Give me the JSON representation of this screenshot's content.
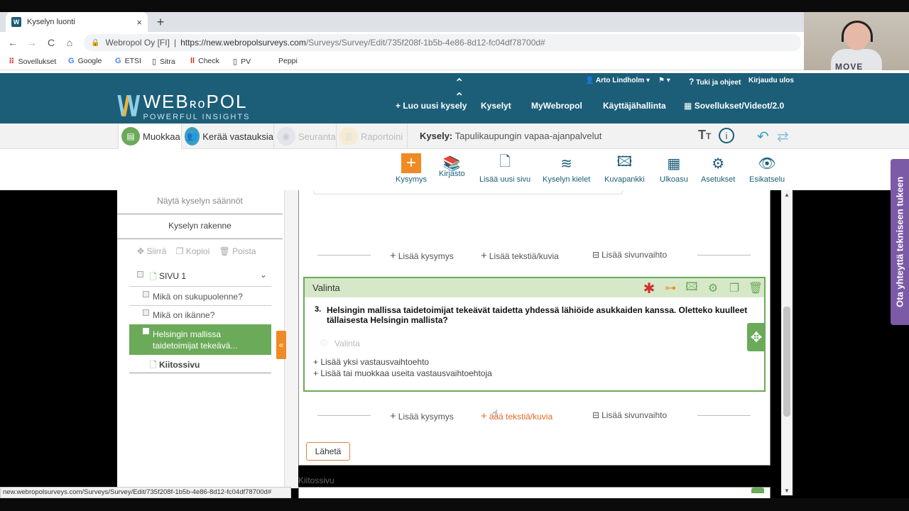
{
  "browser": {
    "tab_title": "Kyselyn luonti",
    "tab_close": "×",
    "new_tab": "+",
    "back": "←",
    "forward": "→",
    "reload": "C",
    "home": "⌂",
    "site_label": "Webropol Oy [FI]",
    "separator": "|",
    "url_host": "https://new.webropolsurveys.com",
    "url_path": "/Surveys/Survey/Edit/735f208f-1b5b-4e86-8d12-fc04df78700d#",
    "bookmarks": [
      "Sovellukset",
      "Google",
      "ETSI",
      "Sitra",
      "Check",
      "PV",
      "Peppi"
    ]
  },
  "webcam": {
    "shirt_text": "MOVE"
  },
  "header": {
    "logo_brand": "WEB",
    "logo_brand2": "POL",
    "logo_tagline": "POWERFUL INSIGHTS",
    "user_name": "Arto Lindholm",
    "help": "Tuki ja ohjeet",
    "logout": "Kirjaudu ulos",
    "nav": [
      "+ Luo uusi kysely",
      "Kyselyt",
      "MyWebropol",
      "Käyttäjähallinta",
      "Sovellukset/Videot/2.0"
    ]
  },
  "tabs": {
    "muokkaa": "Muokkaa",
    "keraa": "Kerää vastauksia",
    "seuranta": "Seuranta",
    "raportointi": "Raportoini",
    "kysely_key": "Kysely:",
    "kysely_name": "Tapulikaupungin vapaa-ajanpalvelut"
  },
  "toolbar": {
    "kysymys": "Kysymys",
    "kirjasto": "Kirjasto",
    "lisaa_sivu": "Lisää uusi sivu",
    "kielet": "Kyselyn kielet",
    "kuvapankki": "Kuvapankki",
    "ulkoasu": "Ulkoasu",
    "asetukset": "Asetukset",
    "esikatselu": "Esikatselu"
  },
  "sidebar": {
    "rules": "Näytä kyselyn säännöt",
    "structure": "Kyselyn rakenne",
    "move": "Siirrä",
    "copy": "Kopioi",
    "delete": "Poista",
    "page1": "SIVU 1",
    "items": [
      "Mikä on sukupuolenne?",
      "Mikä on ikänne?",
      "Helsingin mallissa taidetoimijat tekeävä..."
    ],
    "thanks": "Kiitossivu"
  },
  "main": {
    "add_question": "Lisää kysymys",
    "add_text": "Lisää tekstiä/kuvia",
    "add_text_partial": "äää tekstiä/kuvia",
    "add_pagebreak": "Lisää sivunvaihto",
    "question_type": "Valinta",
    "question_number": "3.",
    "question_text": "Helsingin mallissa taidetoimijat tekeävät taidetta yhdessä lähiöide asukkaiden kanssa. Oletteko kuulleet tällaisesta Helsingin mallista?",
    "option_placeholder": "Valinta",
    "add_one_option": "+ Lisää yksi vastausvaihtoehto",
    "add_many_options": "+ Lisää tai muokkaa useita vastausvaihtoehtoja",
    "submit": "Lähetä",
    "thanks_page": "Kiitossivu"
  },
  "statusbar": "new.webropolsurveys.com/Surveys/Survey/Edit/735f208f-1b5b-4e86-8d12-fc04df78700d#",
  "support_tab": "Ota yhteyttä tekniseen tukeen",
  "colors": {
    "brand": "#1c5e78",
    "green": "#6aaa58",
    "orange": "#f08a24",
    "purple": "#7b5aa6"
  }
}
